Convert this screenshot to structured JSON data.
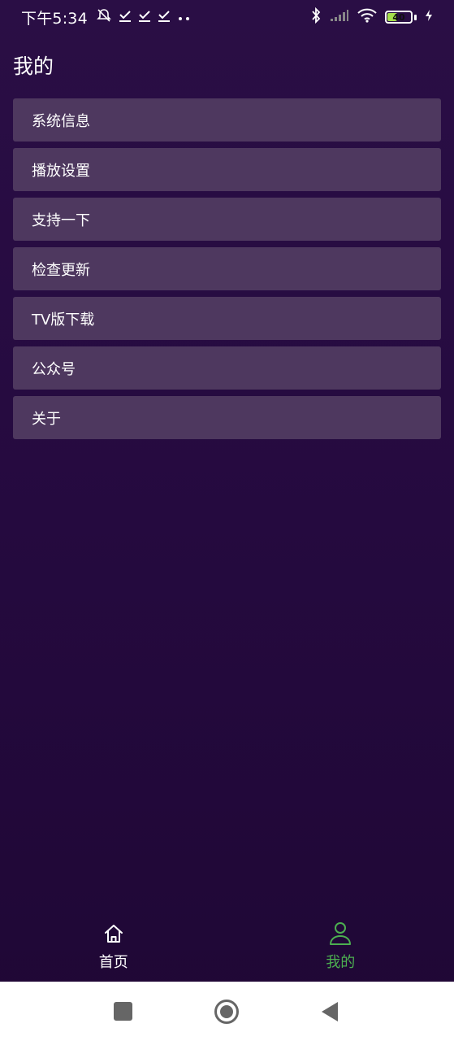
{
  "status_bar": {
    "time": "下午5:34",
    "battery_level": "40",
    "icons": [
      "alarm-off-icon",
      "download-done-icon",
      "download-done-icon",
      "download-done-icon",
      "more-dots-icon",
      "bluetooth-icon",
      "signal-icon",
      "wifi-icon",
      "battery-icon",
      "charging-icon"
    ]
  },
  "page": {
    "title": "我的"
  },
  "menu": {
    "items": [
      {
        "label": "系统信息"
      },
      {
        "label": "播放设置"
      },
      {
        "label": "支持一下"
      },
      {
        "label": "检查更新"
      },
      {
        "label": "TV版下载"
      },
      {
        "label": "公众号"
      },
      {
        "label": "关于"
      }
    ]
  },
  "bottom_nav": {
    "items": [
      {
        "label": "首页",
        "icon": "home-icon",
        "active": false
      },
      {
        "label": "我的",
        "icon": "person-icon",
        "active": true
      }
    ]
  },
  "colors": {
    "background": "#250a3f",
    "menu_item": "#4e385f",
    "active_tab": "#4caf50"
  },
  "system_nav": {
    "buttons": [
      "recents-square-icon",
      "home-circle-icon",
      "back-triangle-icon"
    ]
  }
}
